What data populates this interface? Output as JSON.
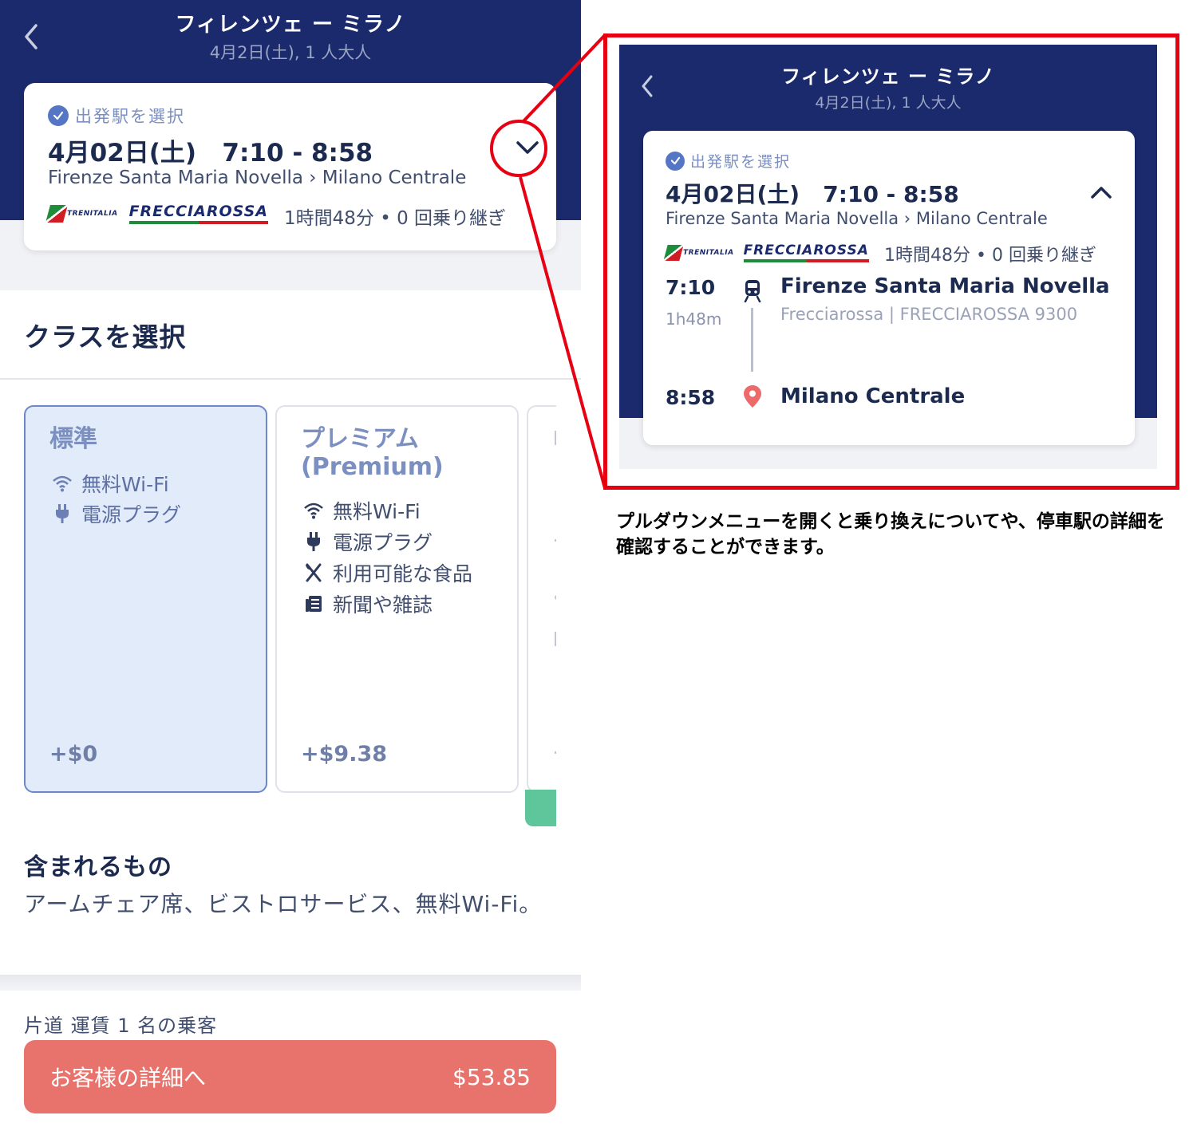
{
  "colors": {
    "header_navy": "#1a2a6c",
    "accent_blue": "#5576c4",
    "cta_coral": "#e8736c",
    "highlight_red": "#e60012",
    "selected_class_bg": "#e2ebf9",
    "green_tab": "#5fc59a"
  },
  "header": {
    "title": "フィレンツェ ー ミラノ",
    "subtitle": "4月2日(土), 1 人大人",
    "back_icon": "chevron-left-icon"
  },
  "trip_card": {
    "selected_label": "出発駅を選択",
    "date_time": "4月02日(土)   7:10 - 8:58",
    "route": "Firenze Santa Maria Novella › Milano Centrale",
    "operator_logos": [
      "TRENITALIA",
      "FRECCIAROSSA"
    ],
    "duration_changes": "1時間48分 • 0 回乗り継ぎ",
    "expand_icon": "chevron-down-icon"
  },
  "class_section": {
    "title": "クラスを選択",
    "classes": [
      {
        "name": "標準",
        "selected": true,
        "amenities": [
          {
            "icon": "wifi-icon",
            "label": "無料Wi-Fi"
          },
          {
            "icon": "plug-icon",
            "label": "電源プラグ"
          }
        ],
        "price": "+$0"
      },
      {
        "name": "プレミアム\n(Premium)",
        "name_line1": "プレミアム",
        "name_line2": "(Premium)",
        "selected": false,
        "amenities": [
          {
            "icon": "wifi-icon",
            "label": "無料Wi-Fi"
          },
          {
            "icon": "plug-icon",
            "label": "電源プラグ"
          },
          {
            "icon": "utensils-icon",
            "label": "利用可能な食品"
          },
          {
            "icon": "newspaper-icon",
            "label": "新聞や雑誌"
          }
        ],
        "price": "+$9.38"
      }
    ]
  },
  "included": {
    "title": "含まれるもの",
    "body": "アームチェア席、ビストロサービス、無料Wi-Fi。"
  },
  "footer": {
    "fare_label": "片道 運賃 1 名の乗客",
    "cta_label": "お客様の詳細へ",
    "cta_price": "$53.85"
  },
  "zoom": {
    "title": "フィレンツェ ー ミラノ",
    "subtitle": "4月2日(土), 1 人大人",
    "selected_label": "出発駅を選択",
    "date_time": "4月02日(土)   7:10 - 8:58",
    "route": "Firenze Santa Maria Novella › Milano Centrale",
    "duration_changes": "1時間48分 • 0 回乗り継ぎ",
    "collapse_icon": "chevron-up-icon",
    "departure": {
      "time": "7:10",
      "travel_time": "1h48m",
      "station": "Firenze Santa Maria Novella",
      "train": "Frecciarossa | FRECCIAROSSA 9300",
      "icon": "train-icon"
    },
    "arrival": {
      "time": "8:58",
      "station": "Milano Centrale",
      "icon": "map-pin-icon"
    }
  },
  "caption": "プルダウンメニューを開くと乗り換えについてや、停車駅の詳細を確認することができます。"
}
